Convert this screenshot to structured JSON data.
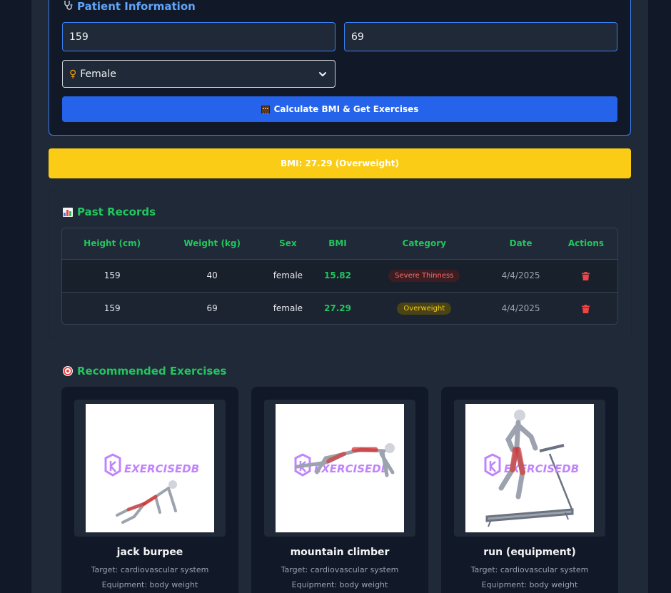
{
  "patient": {
    "title": "Patient Information",
    "title_icon": "stethoscope-icon",
    "height_value": "159",
    "weight_value": "69",
    "sex_selected": "Female",
    "sex_icon": "female-sign-icon",
    "calculate_label": "Calculate BMI & Get Exercises",
    "calculate_icon": "abacus-icon"
  },
  "result": {
    "bmi_text": "BMI: 27.29 (Overweight)",
    "banner_color": "#facc15"
  },
  "records": {
    "title": "Past Records",
    "title_icon": "bar-chart-icon",
    "columns": [
      "Height (cm)",
      "Weight (kg)",
      "Sex",
      "BMI",
      "Category",
      "Date",
      "Actions"
    ],
    "rows": [
      {
        "height": "159",
        "weight": "40",
        "sex": "female",
        "bmi": "15.82",
        "category": "Severe Thinness",
        "date": "4/4/2025"
      },
      {
        "height": "159",
        "weight": "69",
        "sex": "female",
        "bmi": "27.29",
        "category": "Overweight",
        "date": "4/4/2025"
      }
    ],
    "delete_icon": "trash-icon"
  },
  "exercises": {
    "title": "Recommended Exercises",
    "title_icon": "target-icon",
    "watermark": "EXERCISEDB",
    "items": [
      {
        "name": "jack burpee",
        "target": "Target: cardiovascular system",
        "equipment": "Equipment: body weight"
      },
      {
        "name": "mountain climber",
        "target": "Target: cardiovascular system",
        "equipment": "Equipment: body weight"
      },
      {
        "name": "run (equipment)",
        "target": "Target: cardiovascular system",
        "equipment": "Equipment: body weight"
      }
    ]
  },
  "colors": {
    "accent_blue": "#2563eb",
    "accent_green": "#22c55e",
    "warning_yellow": "#facc15",
    "danger_red": "#ef4444"
  }
}
